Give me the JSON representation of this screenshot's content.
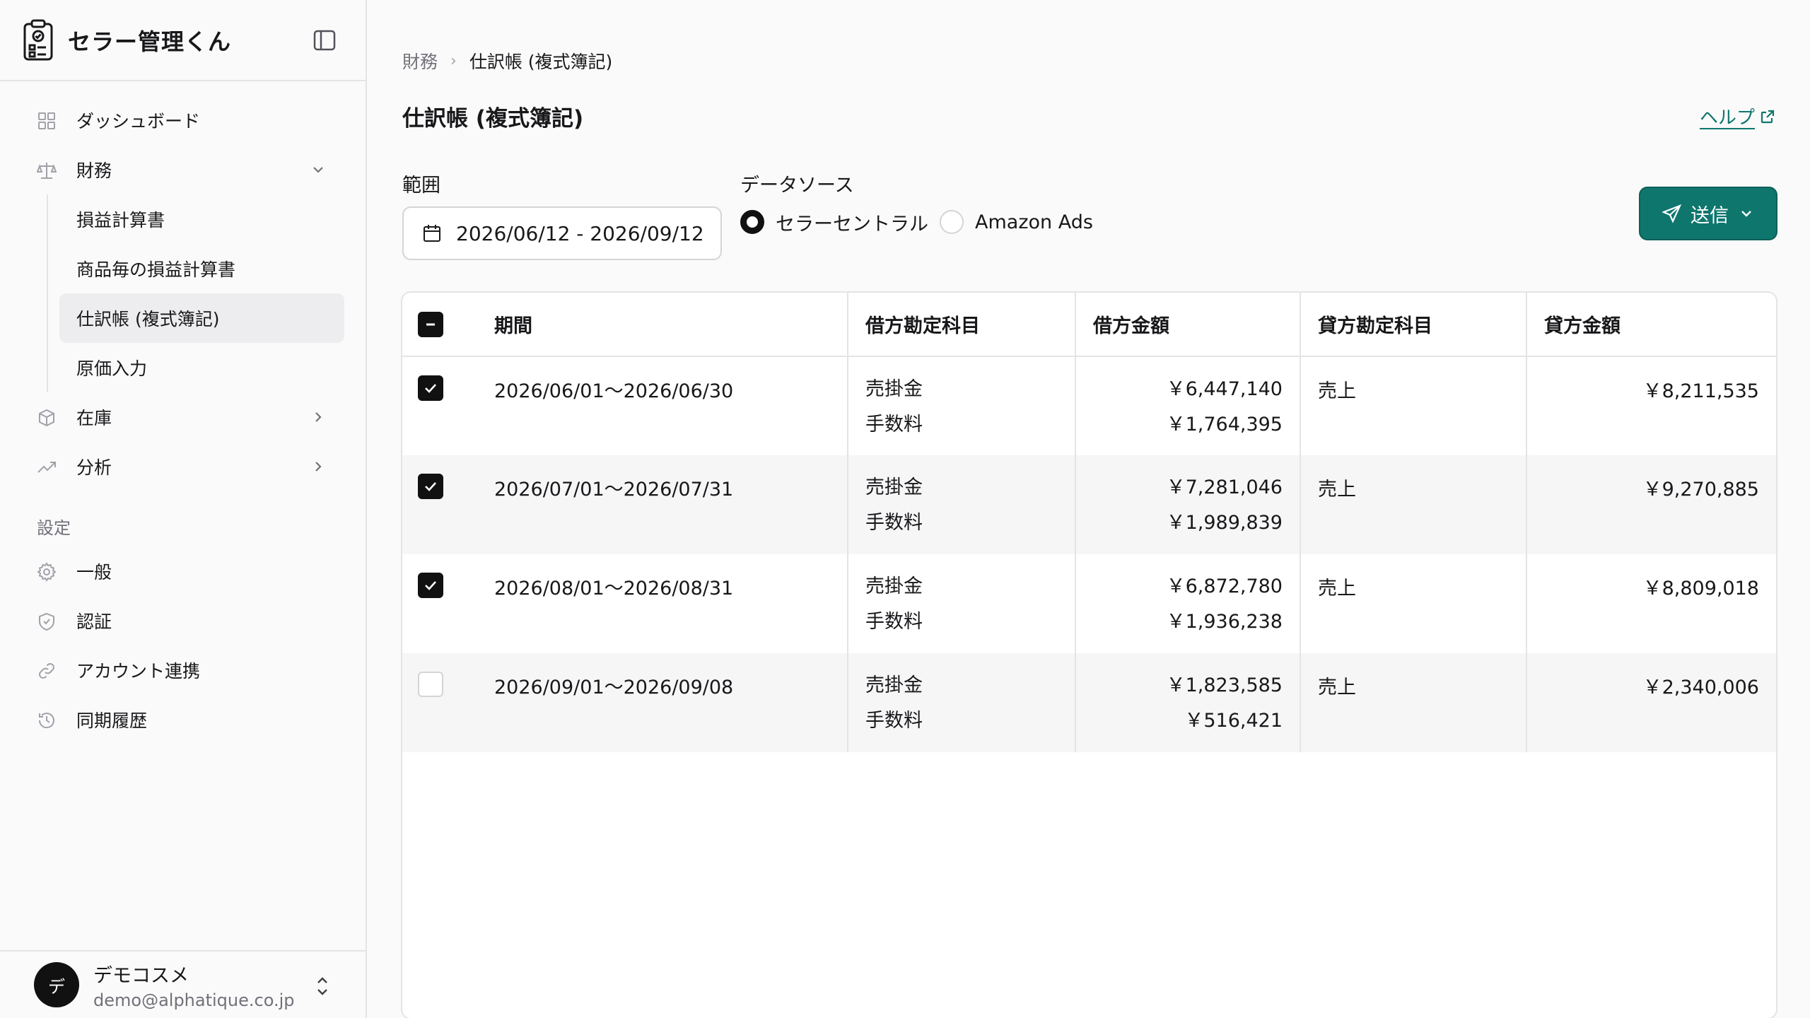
{
  "app": {
    "name": "セラー管理くん"
  },
  "sidebar": {
    "items": [
      {
        "label": "ダッシュボード",
        "icon": "grid-icon"
      },
      {
        "label": "財務",
        "icon": "scale-icon",
        "expanded": true,
        "children": [
          "損益計算書",
          "商品毎の損益計算書",
          "仕訳帳 (複式簿記)",
          "原価入力"
        ]
      },
      {
        "label": "在庫",
        "icon": "box-icon"
      },
      {
        "label": "分析",
        "icon": "trending-up-icon"
      }
    ],
    "settings_label": "設定",
    "settings": [
      {
        "label": "一般",
        "icon": "gear-icon"
      },
      {
        "label": "認証",
        "icon": "shield-icon"
      },
      {
        "label": "アカウント連携",
        "icon": "link-icon"
      },
      {
        "label": "同期履歴",
        "icon": "history-icon"
      }
    ],
    "user": {
      "avatar": "デ",
      "name": "デモコスメ",
      "email": "demo@alphatique.co.jp"
    }
  },
  "breadcrumb": {
    "parent": "財務",
    "current": "仕訳帳 (複式簿記)"
  },
  "page": {
    "title": "仕訳帳 (複式簿記)",
    "help": "ヘルプ"
  },
  "filters": {
    "range_label": "範囲",
    "range_value": "2026/06/12 - 2026/09/12",
    "source_label": "データソース",
    "sources": [
      {
        "label": "セラーセントラル",
        "selected": true
      },
      {
        "label": "Amazon Ads",
        "selected": false
      }
    ],
    "send_label": "送信"
  },
  "table": {
    "headers": [
      "期間",
      "借方勘定科目",
      "借方金額",
      "貸方勘定科目",
      "貸方金額"
    ],
    "rows": [
      {
        "checked": true,
        "period": "2026/06/01〜2026/06/30",
        "debit_acc1": "売掛金",
        "debit_acc2": "手数料",
        "debit_amt1": "￥6,447,140",
        "debit_amt2": "￥1,764,395",
        "credit_acc": "売上",
        "credit_amt": "￥8,211,535"
      },
      {
        "checked": true,
        "period": "2026/07/01〜2026/07/31",
        "debit_acc1": "売掛金",
        "debit_acc2": "手数料",
        "debit_amt1": "￥7,281,046",
        "debit_amt2": "￥1,989,839",
        "credit_acc": "売上",
        "credit_amt": "￥9,270,885"
      },
      {
        "checked": true,
        "period": "2026/08/01〜2026/08/31",
        "debit_acc1": "売掛金",
        "debit_acc2": "手数料",
        "debit_amt1": "￥6,872,780",
        "debit_amt2": "￥1,936,238",
        "credit_acc": "売上",
        "credit_amt": "￥8,809,018"
      },
      {
        "checked": false,
        "period": "2026/09/01〜2026/09/08",
        "debit_acc1": "売掛金",
        "debit_acc2": "手数料",
        "debit_amt1": "￥1,823,585",
        "debit_amt2": "￥516,421",
        "credit_acc": "売上",
        "credit_amt": "￥2,340,006"
      }
    ]
  },
  "colors": {
    "accent": "#0f766e",
    "text": "#18181b",
    "muted": "#71717a",
    "border": "#e4e4e7"
  }
}
